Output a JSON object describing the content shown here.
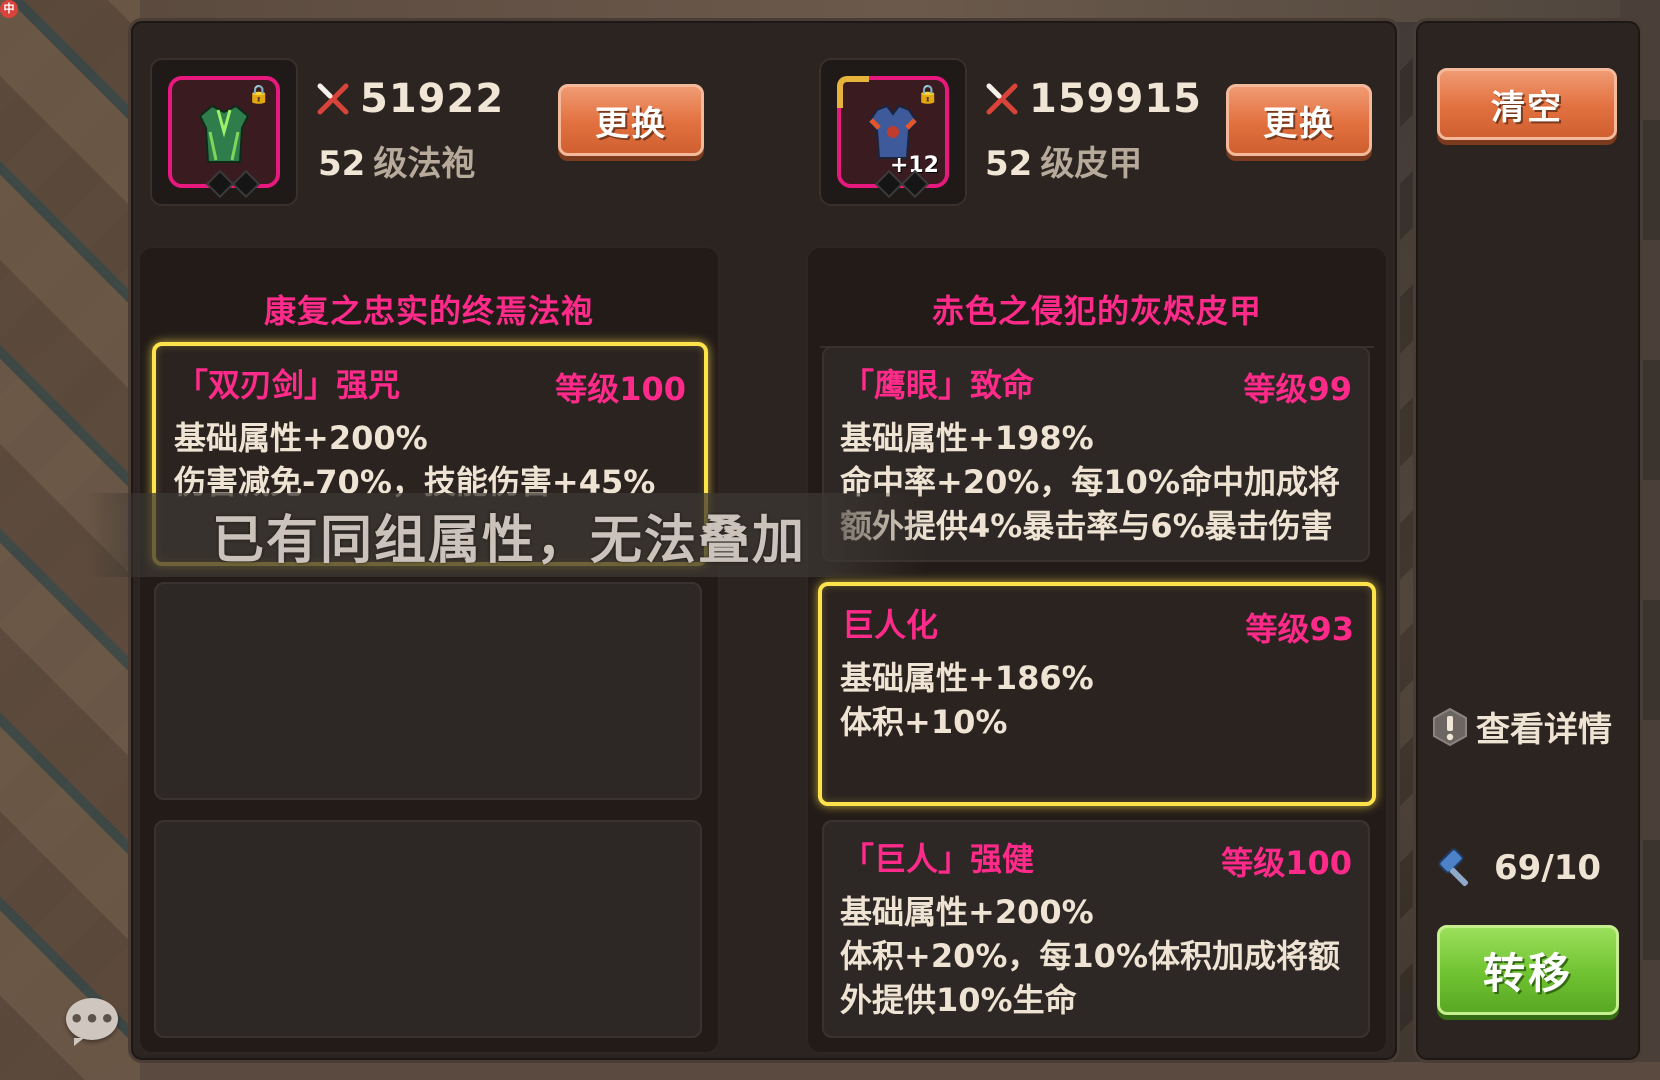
{
  "left_item": {
    "power": "51922",
    "level": "52",
    "kind": "级法袍",
    "replace_label": "更换",
    "title": "康复之忠实的终焉法袍",
    "affixes": [
      {
        "name": "「双刃剑」强咒",
        "level": "等级100",
        "lines": [
          "基础属性+200%",
          "伤害减免-70%，技能伤害+45%"
        ],
        "selected": true
      }
    ]
  },
  "right_item": {
    "power": "159915",
    "level": "52",
    "kind": "级皮甲",
    "plus": "+12",
    "replace_label": "更换",
    "title": "赤色之侵犯的灰烬皮甲",
    "affixes": [
      {
        "name": "「鹰眼」致命",
        "level": "等级99",
        "lines": [
          "基础属性+198%",
          "命中率+20%，每10%命中加成将",
          "额外提供4%暴击率与6%暴击伤害"
        ],
        "selected": false
      },
      {
        "name": "巨人化",
        "level": "等级93",
        "lines": [
          "基础属性+186%",
          "体积+10%"
        ],
        "selected": true
      },
      {
        "name": "「巨人」强健",
        "level": "等级100",
        "lines": [
          "基础属性+200%",
          "体积+20%，每10%体积加成将额",
          "外提供10%生命"
        ],
        "selected": false
      }
    ]
  },
  "sidebar": {
    "clear_label": "清空",
    "details_label": "查看详情",
    "counter": "69/10",
    "transfer_label": "转移"
  },
  "toast": "已有同组属性，无法叠加",
  "notif_badge": "中",
  "colors": {
    "affix_pink": "#ff2a8a",
    "select_gold": "#ffe34a",
    "button_orange": "#e2703f",
    "button_green": "#6fc231"
  }
}
